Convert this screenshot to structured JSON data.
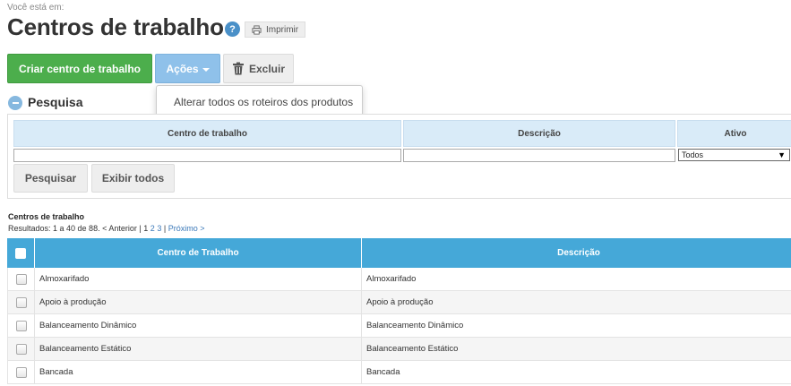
{
  "breadcrumb": {
    "label": "Você está em:"
  },
  "page": {
    "title": "Centros de trabalho",
    "help": "?",
    "print_label": "Imprimir"
  },
  "toolbar": {
    "create_label": "Criar centro de trabalho",
    "actions_label": "Ações",
    "delete_label": "Excluir"
  },
  "actions_menu": {
    "items": [
      "Alterar todos os roteiros dos produtos"
    ]
  },
  "search": {
    "title": "Pesquisa",
    "headers": {
      "center": "Centro de trabalho",
      "description": "Descrição",
      "active": "Ativo"
    },
    "center_value": "",
    "description_value": "",
    "active_selected": "Todos",
    "search_label": "Pesquisar",
    "show_all_label": "Exibir todos"
  },
  "results": {
    "title": "Centros de trabalho",
    "summary": "Resultados: 1 a 40 de 88.",
    "prev": "< Anterior",
    "sep1": "|",
    "page_current": "1",
    "page_2": "2",
    "page_3": "3",
    "sep2": "|",
    "next": "Próximo >"
  },
  "grid": {
    "headers": {
      "center": "Centro de Trabalho",
      "description": "Descrição"
    },
    "rows": [
      {
        "center": "Almoxarifado",
        "description": "Almoxarifado"
      },
      {
        "center": "Apoio à produção",
        "description": "Apoio à produção"
      },
      {
        "center": "Balanceamento Dinâmico",
        "description": "Balanceamento Dinâmico"
      },
      {
        "center": "Balanceamento Estático",
        "description": "Balanceamento Estático"
      },
      {
        "center": "Bancada",
        "description": "Bancada"
      }
    ]
  },
  "colors": {
    "create": "#4cae4c",
    "actions": "#8fc1ea",
    "grid_header": "#45a8d8",
    "link": "#3a78b8"
  }
}
